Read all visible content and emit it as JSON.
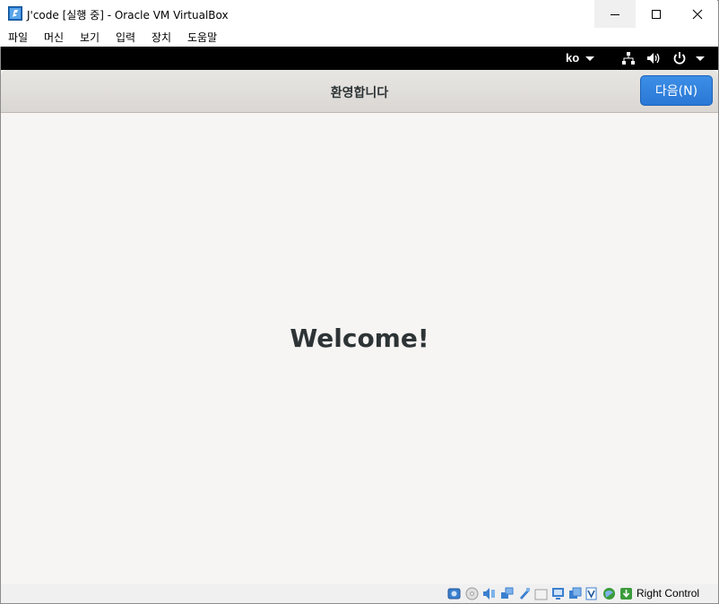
{
  "window": {
    "title": "J'code [실행 중] - Oracle VM VirtualBox",
    "icon": "virtualbox-icon"
  },
  "menu": {
    "items": [
      "파일",
      "머신",
      "보기",
      "입력",
      "장치",
      "도움말"
    ]
  },
  "guest": {
    "topbar": {
      "language": "ko",
      "icons": [
        "network-icon",
        "volume-icon",
        "power-icon"
      ]
    },
    "header": {
      "title": "환영합니다",
      "next_button": "다음(N)"
    },
    "content": {
      "heading": "Welcome!"
    }
  },
  "statusbar": {
    "icons": [
      "hard-disk-icon",
      "optical-drive-icon",
      "audio-icon",
      "network-adapter-icon",
      "usb-icon",
      "shared-folders-icon",
      "display-icon",
      "video-capture-icon",
      "cpu-icon",
      "mouse-integration-icon",
      "keyboard-capture-icon"
    ],
    "host_key": "Right Control"
  },
  "colors": {
    "accent": "#2a78d6",
    "guest_background": "#f6f5f4",
    "topbar": "#000000"
  }
}
